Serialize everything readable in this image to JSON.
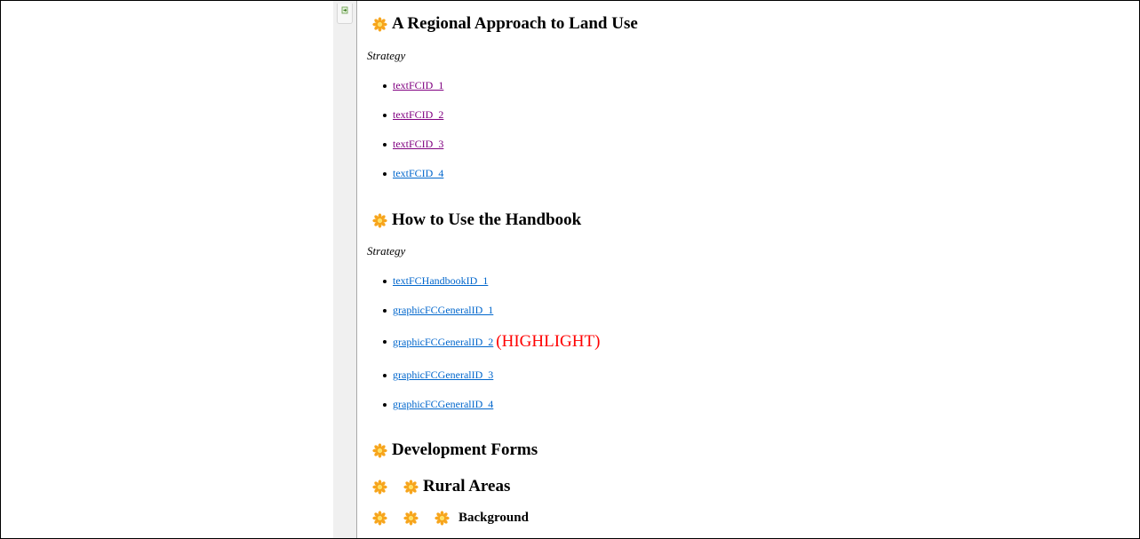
{
  "colors": {
    "visited_link": "#800080",
    "link": "#0066cc",
    "highlight": "#ff0000",
    "flower_petals": "#f7a51c",
    "flower_center": "#ffe066"
  },
  "icons": {
    "section": "flower-icon",
    "collapse": "expand-arrow-icon"
  },
  "sections": [
    {
      "title": "A Regional Approach to Land Use",
      "strategy_label": "Strategy",
      "links": [
        "textFCID_1",
        "textFCID_2",
        "textFCID_3",
        "textFCID_4"
      ]
    },
    {
      "title": "How to Use the Handbook",
      "strategy_label": "Strategy",
      "links": [
        "textFCHandbookID_1",
        "graphicFCGeneralID_1",
        "graphicFCGeneralID_2",
        "graphicFCGeneralID_3",
        "graphicFCGeneralID_4"
      ],
      "highlight_label": "(HIGHLIGHT)"
    },
    {
      "title": "Development Forms"
    },
    {
      "title": "Rural Areas"
    },
    {
      "title": "Background"
    }
  ]
}
